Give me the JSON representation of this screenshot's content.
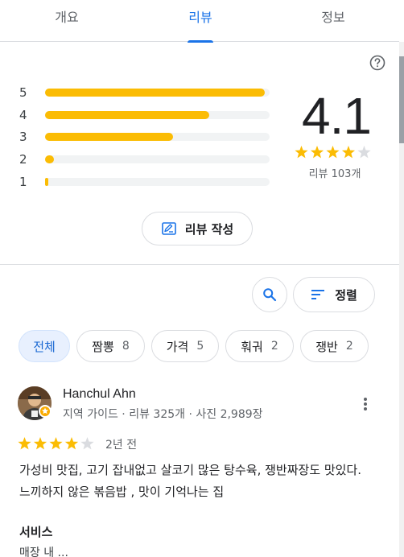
{
  "tabs": [
    {
      "label": "개요",
      "active": false
    },
    {
      "label": "리뷰",
      "active": true
    },
    {
      "label": "정보",
      "active": false
    }
  ],
  "summary": {
    "histogram": [
      {
        "label": "5",
        "fraction": 0.98
      },
      {
        "label": "4",
        "fraction": 0.73
      },
      {
        "label": "3",
        "fraction": 0.57
      },
      {
        "label": "2",
        "fraction": 0.04
      },
      {
        "label": "1",
        "fraction": 0.01
      }
    ],
    "score": "4.1",
    "stars": 4,
    "review_count": "리뷰 103개",
    "help_icon": "help-circle-icon"
  },
  "write_review": {
    "label": "리뷰 작성",
    "icon": "edit-review-icon"
  },
  "search": {
    "icon": "search-icon"
  },
  "sort": {
    "label": "정렬",
    "icon": "sort-icon"
  },
  "chips": [
    {
      "label": "전체",
      "count": "",
      "active": true
    },
    {
      "label": "짬뽕",
      "count": "8",
      "active": false
    },
    {
      "label": "가격",
      "count": "5",
      "active": false
    },
    {
      "label": "훠궈",
      "count": "2",
      "active": false
    },
    {
      "label": "쟁반",
      "count": "2",
      "active": false
    }
  ],
  "review": {
    "author": "Hanchul Ahn",
    "meta": "지역 가이드 · 리뷰 325개 · 사진 2,989장",
    "stars": 4,
    "date": "2년 전",
    "text": "가성비 맛집, 고기 잡내없고 살코기 많은 탕수육, 쟁반짜장도 맛있다. 느끼하지 않은 볶음밥 , 맛이 기억나는 집",
    "section_title": "서비스",
    "section_text": "매장 내 ..."
  },
  "colors": {
    "accent": "#1a73e8",
    "star": "#fbbc04",
    "star_empty": "#dadce0"
  }
}
